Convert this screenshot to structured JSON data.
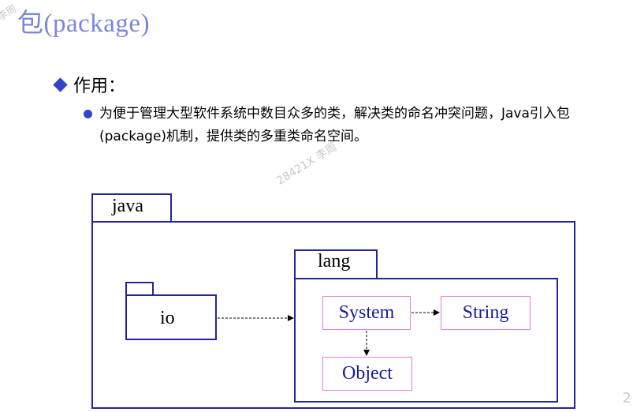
{
  "watermark": {
    "top": "李周",
    "middle": "28421X 李周",
    "corner": "2"
  },
  "title": "包(package)",
  "section": {
    "heading": "作用：",
    "bullet": "为便于管理大型软件系统中数目众多的类，解决类的命名冲突问题，Java引入包(package)机制，提供类的多重类命名空间。"
  },
  "diagram": {
    "outer_package": "java",
    "inner_package": "lang",
    "io_package": "io",
    "classes": {
      "system": "System",
      "string": "String",
      "object": "Object"
    }
  },
  "colors": {
    "title": "#7a86d8",
    "package_border": "#2323a8",
    "class_border": "#e080e0",
    "bullet": "#3344cc"
  }
}
